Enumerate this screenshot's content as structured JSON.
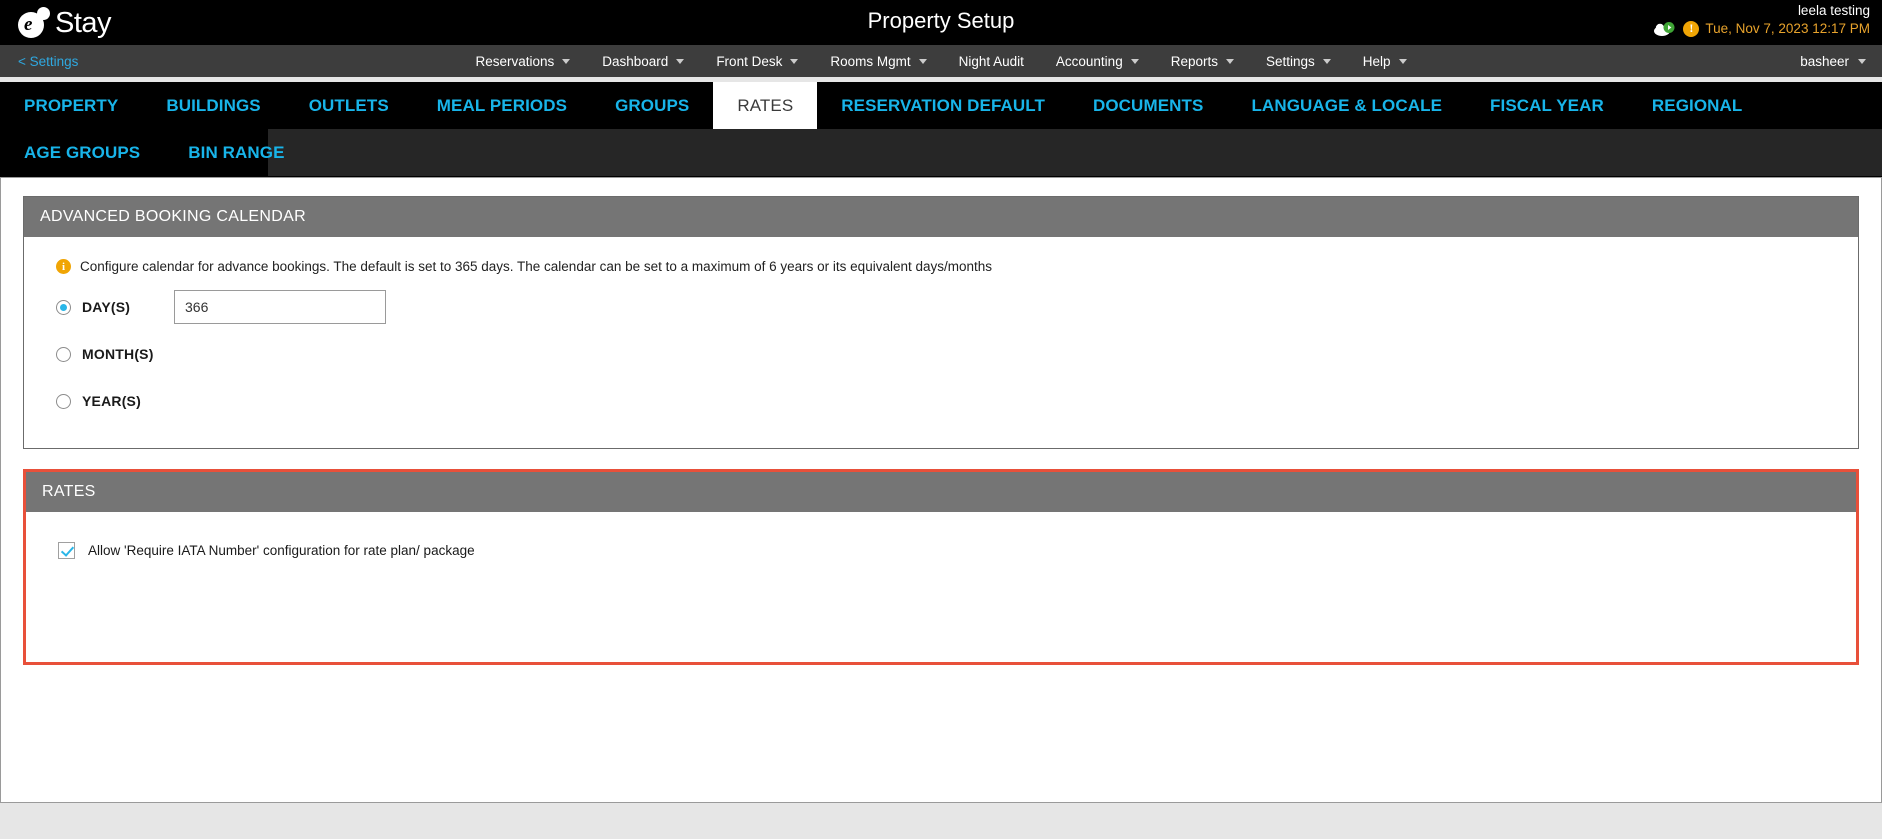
{
  "header": {
    "logo_text": "Stay",
    "logo_letter": "e",
    "title": "Property Setup",
    "user_name": "leela testing",
    "datetime": "Tue, Nov 7, 2023 12:17 PM",
    "cloud_icon": "cloud-sync-icon",
    "warning_icon": "warning-icon"
  },
  "nav": {
    "back_label": "< Settings",
    "items": [
      {
        "label": "Reservations",
        "caret": true
      },
      {
        "label": "Dashboard",
        "caret": true
      },
      {
        "label": "Front Desk",
        "caret": true
      },
      {
        "label": "Rooms Mgmt",
        "caret": true
      },
      {
        "label": "Night Audit",
        "caret": false
      },
      {
        "label": "Accounting",
        "caret": true
      },
      {
        "label": "Reports",
        "caret": true
      },
      {
        "label": "Settings",
        "caret": true
      },
      {
        "label": "Help",
        "caret": true
      }
    ],
    "account_label": "basheer"
  },
  "tabs": {
    "row1": [
      {
        "label": "PROPERTY",
        "active": false
      },
      {
        "label": "BUILDINGS",
        "active": false
      },
      {
        "label": "OUTLETS",
        "active": false
      },
      {
        "label": "MEAL PERIODS",
        "active": false
      },
      {
        "label": "GROUPS",
        "active": false
      },
      {
        "label": "RATES",
        "active": true
      },
      {
        "label": "RESERVATION DEFAULT",
        "active": false
      },
      {
        "label": "DOCUMENTS",
        "active": false
      },
      {
        "label": "LANGUAGE & LOCALE",
        "active": false
      },
      {
        "label": "FISCAL YEAR",
        "active": false
      },
      {
        "label": "REGIONAL",
        "active": false
      }
    ],
    "row2": [
      {
        "label": "AGE GROUPS",
        "active": false
      },
      {
        "label": "BIN RANGE",
        "active": false
      }
    ]
  },
  "advanced_booking_calendar": {
    "panel_title": "ADVANCED BOOKING CALENDAR",
    "info_text": "Configure calendar for advance bookings. The default is set to 365 days. The calendar can be set to a maximum of 6 years or its equivalent days/months",
    "options": [
      {
        "label": "DAY(S)",
        "selected": true
      },
      {
        "label": "MONTH(S)",
        "selected": false
      },
      {
        "label": "YEAR(S)",
        "selected": false
      }
    ],
    "days_value": "366",
    "days_placeholder": ""
  },
  "rates": {
    "panel_title": "RATES",
    "checkbox_label": "Allow 'Require IATA Number' configuration for rate plan/ package",
    "checkbox_checked": true,
    "highlight_color": "#e8503a"
  }
}
